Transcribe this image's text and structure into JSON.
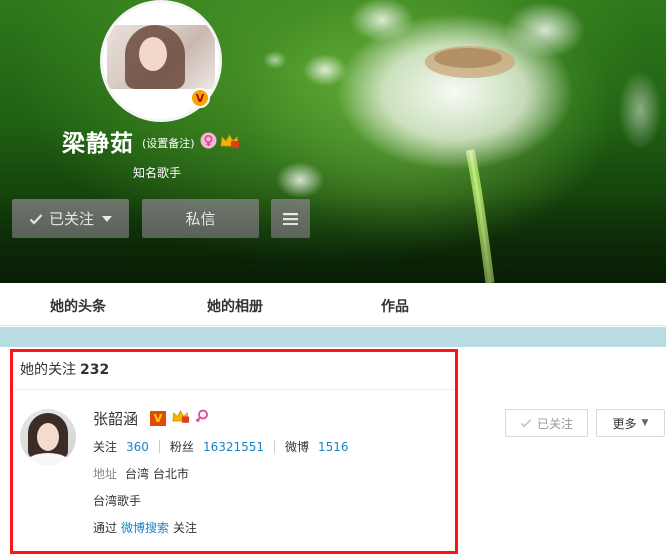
{
  "profile": {
    "name": "梁静茹",
    "remark_link": "(设置备注)",
    "title": "知名歌手",
    "follow_button": "已关注",
    "message_button": "私信",
    "verified_mark": "V"
  },
  "tabs": [
    {
      "label": "她的头条"
    },
    {
      "label": "她的相册"
    },
    {
      "label": "作品"
    }
  ],
  "following_section": {
    "title": "她的关注",
    "count": "232"
  },
  "user_card": {
    "name": "张韶涵",
    "verified_mark": "V",
    "stats": [
      {
        "label": "关注",
        "value": "360"
      },
      {
        "label": "粉丝",
        "value": "16321551"
      },
      {
        "label": "微博",
        "value": "1516"
      }
    ],
    "address_label": "地址",
    "address": "台湾 台北市",
    "description": "台湾歌手",
    "via_prefix": "通过",
    "via_link": "微博搜索",
    "via_suffix": "关注",
    "followed_button": "已关注",
    "more_button": "更多"
  },
  "colors": {
    "link_blue": "#1b84c6",
    "highlight_red": "#ff1414",
    "tab_strip": "#b9dbe2"
  }
}
